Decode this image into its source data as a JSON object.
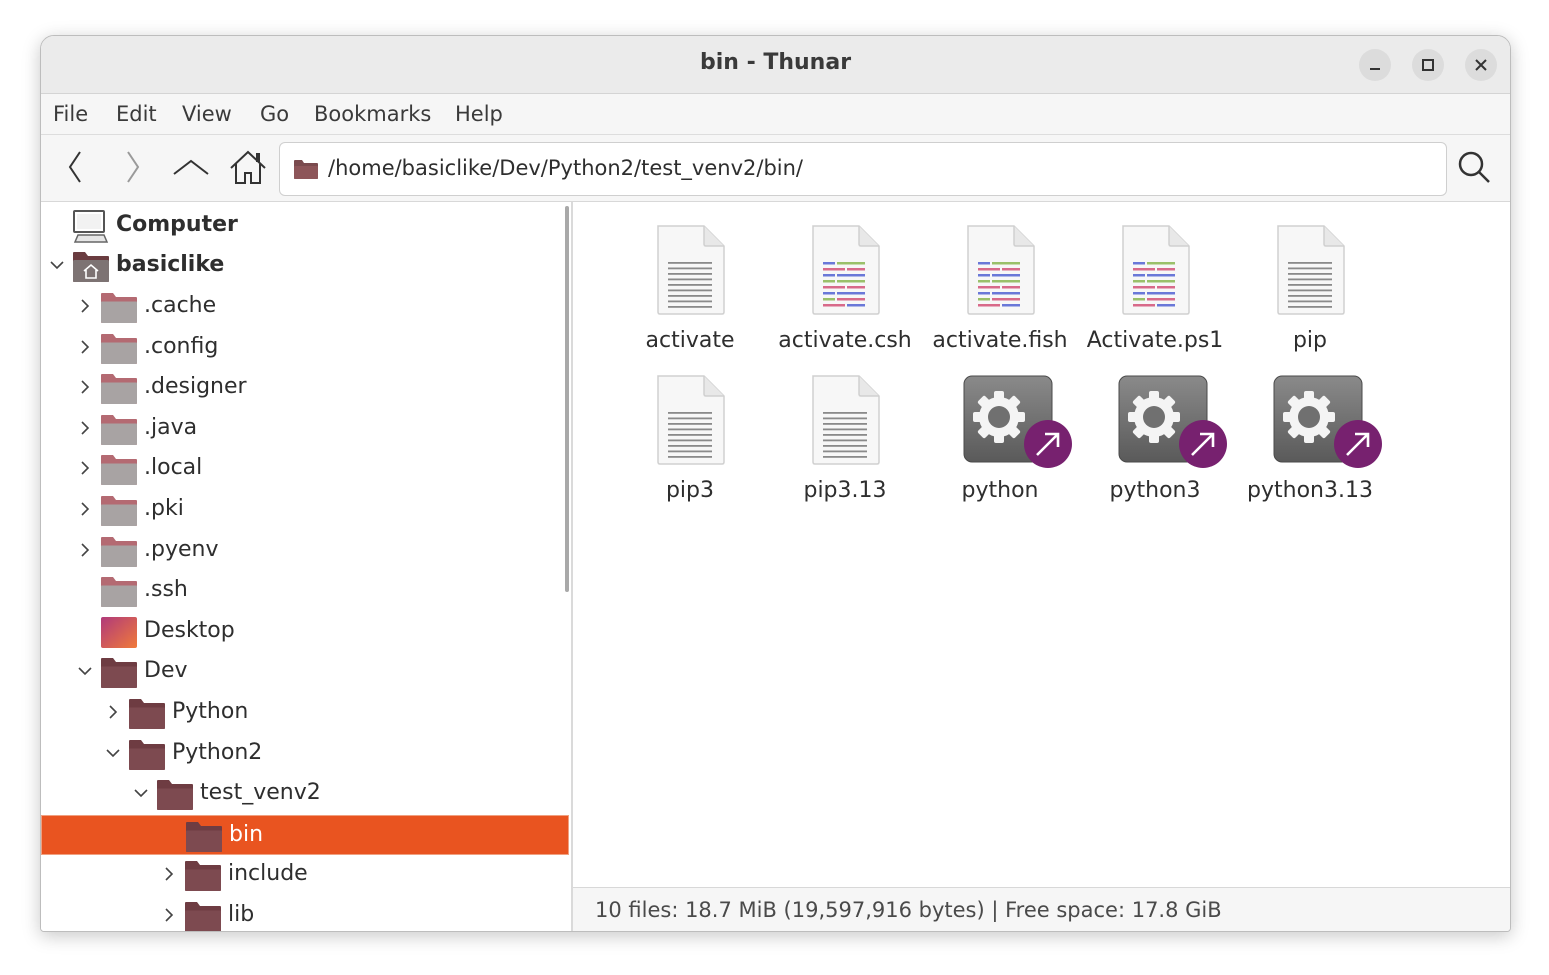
{
  "window": {
    "title": "bin - Thunar",
    "controls": {
      "minimize": "minimize",
      "maximize": "maximize",
      "close": "close"
    }
  },
  "menubar": {
    "items": [
      "File",
      "Edit",
      "View",
      "Go",
      "Bookmarks",
      "Help"
    ]
  },
  "toolbar": {
    "icons": [
      "back-arrow-icon",
      "forward-arrow-icon",
      "parent-folder-icon",
      "home-icon",
      "search-icon"
    ],
    "location": "/home/basiclike/Dev/Python2/test_venv2/bin/"
  },
  "sidepane": {
    "items": [
      {
        "label": "Computer",
        "bold": true,
        "expander": "none"
      },
      {
        "label": "basiclike",
        "bold": true,
        "expander": "expanded"
      },
      {
        "label": ".cache",
        "expander": "collapsed"
      },
      {
        "label": ".config",
        "expander": "collapsed"
      },
      {
        "label": ".designer",
        "expander": "collapsed"
      },
      {
        "label": ".java",
        "expander": "collapsed"
      },
      {
        "label": ".local",
        "expander": "collapsed"
      },
      {
        "label": ".pki",
        "expander": "collapsed"
      },
      {
        "label": ".pyenv",
        "expander": "collapsed"
      },
      {
        "label": ".ssh",
        "expander": "none"
      },
      {
        "label": "Desktop",
        "expander": "none"
      },
      {
        "label": "Dev",
        "expander": "expanded"
      },
      {
        "label": "Python",
        "expander": "collapsed"
      },
      {
        "label": "Python2",
        "expander": "expanded"
      },
      {
        "label": "test_venv2",
        "expander": "expanded"
      },
      {
        "label": "bin",
        "expander": "none",
        "selected": true
      },
      {
        "label": "include",
        "expander": "collapsed"
      },
      {
        "label": "lib",
        "expander": "collapsed"
      }
    ]
  },
  "files": [
    {
      "name": "activate",
      "icon": "plain-text-file-icon"
    },
    {
      "name": "activate.csh",
      "icon": "script-file-icon"
    },
    {
      "name": "activate.fish",
      "icon": "script-file-icon"
    },
    {
      "name": "Activate.ps1",
      "icon": "script-file-icon"
    },
    {
      "name": "pip",
      "icon": "plain-text-file-icon"
    },
    {
      "name": "pip3",
      "icon": "plain-text-file-icon"
    },
    {
      "name": "pip3.13",
      "icon": "plain-text-file-icon"
    },
    {
      "name": "python",
      "icon": "executable-symlink-icon"
    },
    {
      "name": "python3",
      "icon": "executable-symlink-icon"
    },
    {
      "name": "python3.13",
      "icon": "executable-symlink-icon"
    }
  ],
  "statusbar": {
    "text": "10 files: 18.7 MiB (19,597,916 bytes)  |  Free space: 17.8 GiB"
  },
  "colors": {
    "selection": "#e95420",
    "symlink_badge": "#77216f",
    "folder": "#7a4a4e"
  }
}
